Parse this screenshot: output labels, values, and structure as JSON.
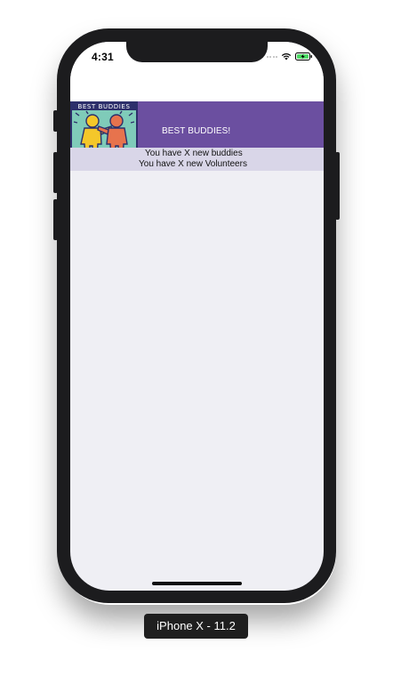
{
  "status_bar": {
    "time": "4:31",
    "icons": [
      "cellular-signal-icon",
      "wifi-icon",
      "battery-charging-icon"
    ]
  },
  "header": {
    "logo_text": "BEST BUDDIES",
    "title": "BEST BUDDIES!",
    "background_color": "#6b4fa0"
  },
  "notifications": {
    "buddies_text": "You have X new buddies",
    "volunteers_text": "You have X new Volunteers",
    "background_color": "#d9d6e8"
  },
  "device": {
    "label": "iPhone X - 11.2"
  }
}
